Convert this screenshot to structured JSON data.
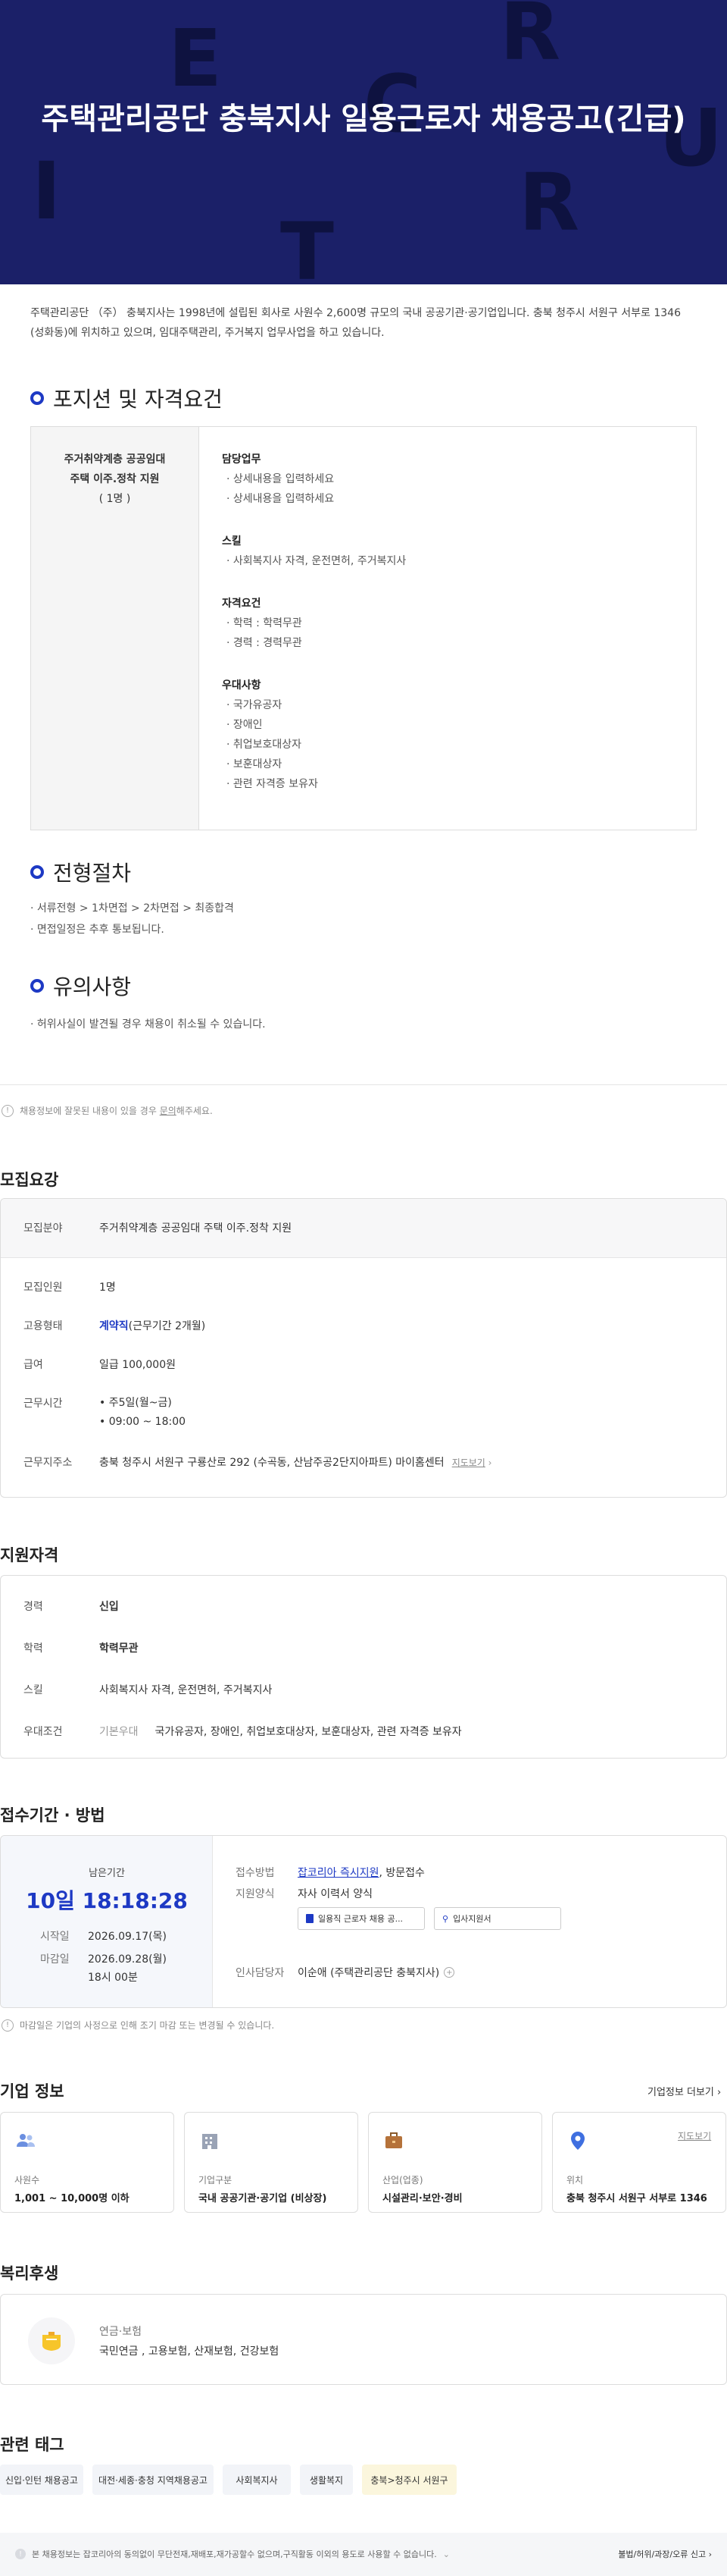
{
  "hero": {
    "title": "주택관리공단 충북지사 일용근로자 채용공고(긴급)",
    "bg_letters": [
      "E",
      "C",
      "R",
      "I",
      "U",
      "T",
      "R"
    ]
  },
  "intro": "주택관리공단 （주） 충북지사는 1998년에 설립된 회사로 사원수 2,600명 규모의 국내 공공기관·공기업입니다. 충북 청주시 서원구 서부로 1346 (성화동)에 위치하고 있으며, 임대주택관리, 주거복지 업무사업을 하고 있습니다.",
  "position": {
    "heading": "포지션 및 자격요건",
    "title_lines": [
      "주거취약계층 공공임대",
      "주택 이주.정착 지원",
      "( 1명 )"
    ],
    "groups": [
      {
        "h": "담당업무",
        "items": [
          "· 상세내용을 입력하세요",
          "· 상세내용을 입력하세요"
        ]
      },
      {
        "h": "스킬",
        "items": [
          "· 사회복지사 자격, 운전면허, 주거복지사"
        ]
      },
      {
        "h": "자격요건",
        "items": [
          "· 학력 : 학력무관",
          "· 경력 : 경력무관"
        ]
      },
      {
        "h": "우대사항",
        "items": [
          "· 국가유공자",
          "· 장애인",
          "· 취업보호대상자",
          "· 보훈대상자",
          "· 관련 자격증 보유자"
        ]
      }
    ]
  },
  "process": {
    "heading": "전형절차",
    "lines": [
      "· 서류전형 > 1차면접 > 2차면접  > 최종합격",
      "· 면접일정은 추후 통보됩니다."
    ]
  },
  "caution": {
    "heading": "유의사항",
    "lines": [
      "· 허위사실이 발견될 경우 채용이 취소될 수 있습니다."
    ]
  },
  "report_note": {
    "pre": "채용정보에 잘못된 내용이 있을 경우 ",
    "link": "문의",
    "post": "해주세요."
  },
  "recruit": {
    "heading": "모집요강",
    "field_k": "모집분야",
    "field_v": "주거취약계층 공공임대 주택 이주.정착 지원",
    "count_k": "모집인원",
    "count_v": "1명",
    "type_k": "고용형태",
    "type_v1": "계약직",
    "type_v2": "(근무기간 2개월)",
    "pay_k": "급여",
    "pay_v": "일급 100,000원",
    "time_k": "근무시간",
    "time_v1": "• 주5일(월~금)",
    "time_v2": "• 09:00 ~ 18:00",
    "addr_k": "근무지주소",
    "addr_v": "충북 청주시 서원구 구룡산로 292 (수곡동, 산남주공2단지아파트) 마이홈센터",
    "addr_link": "지도보기"
  },
  "qual": {
    "heading": "지원자격",
    "career_k": "경력",
    "career_v": "신입",
    "edu_k": "학력",
    "edu_v": "학력무관",
    "skill_k": "스킬",
    "skill_v": "사회복지사 자격, 운전면허, 주거복지사",
    "pref_k": "우대조건",
    "pref_tag": "기본우대",
    "pref_v": "국가유공자, 장애인, 취업보호대상자, 보훈대상자, 관련 자격증 보유자"
  },
  "apply": {
    "heading": "접수기간 · 방법",
    "remain_label": "남은기간",
    "remain_value": "10일 18:18:28",
    "start_k": "시작일",
    "start_v": "2026.09.17(목)",
    "end_k": "마감일",
    "end_v1": "2026.09.28(월)",
    "end_v2": "18시 00분",
    "method_k": "접수방법",
    "method_link": "잡코리아 즉시지원",
    "method_rest": ", 방문접수",
    "form_k": "지원양식",
    "form_v": "자사 이력서 양식",
    "file1": "일용직 근로자 채용 공...",
    "file2": "입사지원서",
    "hr_k": "인사담당자",
    "hr_v": "이순애 (주택관리공단 충북지사)",
    "note": "마감일은 기업의 사정으로 인해 조기 마감 또는 변경될 수 있습니다."
  },
  "company": {
    "heading": "기업 정보",
    "more": "기업정보 더보기",
    "boxes": [
      {
        "icon": "people-icon",
        "label": "사원수",
        "value": "1,001 ~ 10,000명 이하"
      },
      {
        "icon": "building-icon",
        "label": "기업구분",
        "value": "국내 공공기관·공기업 (비상장)"
      },
      {
        "icon": "briefcase-icon",
        "label": "산업(업종)",
        "value": "시설관리·보안·경비"
      },
      {
        "icon": "location-icon",
        "label": "위치",
        "value": "충북 청주시 서원구 서부로 1346",
        "link": "지도보기"
      }
    ]
  },
  "welfare": {
    "heading": "복리후생",
    "cat": "연금·보험",
    "items": "국민연금 , 고용보험, 산재보험, 건강보험"
  },
  "tags": {
    "heading": "관련 태그",
    "items": [
      "신입·인턴 채용공고",
      "대전·세종·충청 지역채용공고",
      "사회복지사",
      "생활복지",
      "충북>청주시 서원구"
    ]
  },
  "footer": {
    "notice": "본 채용정보는 잡코리아의 동의없이 무단전재,재배포,재가공할수 없으며,구직활동 이외의 용도로 사용할 수 없습니다.",
    "report": "불법/허위/과장/오류 신고"
  },
  "colors": {
    "hero_bg": "#1b2068",
    "accent": "#1d39c4"
  }
}
